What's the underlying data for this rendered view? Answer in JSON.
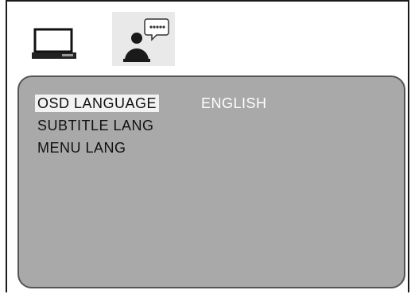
{
  "tabs": [
    {
      "icon": "tv-icon",
      "selected": false
    },
    {
      "icon": "setup-icon",
      "selected": true
    }
  ],
  "menu": {
    "items": [
      {
        "label": "OSD LANGUAGE",
        "selected": true
      },
      {
        "label": "SUBTITLE LANG",
        "selected": false
      },
      {
        "label": "MENU LANG",
        "selected": false
      }
    ],
    "selected_value": "ENGLISH"
  },
  "colors": {
    "panel": "#a9a9a9",
    "highlight": "#f2f2f2",
    "value_text": "#ffffff"
  }
}
